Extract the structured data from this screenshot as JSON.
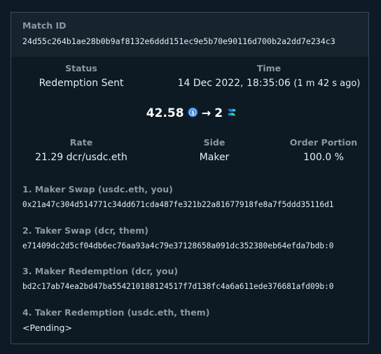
{
  "match": {
    "id_label": "Match ID",
    "id_value": "24d55c264b1ae28b0b9af8132e6ddd151ec9e5b70e90116d700b2a2dd7e234c3"
  },
  "status": {
    "label": "Status",
    "value": "Redemption Sent"
  },
  "time": {
    "label": "Time",
    "value": "14 Dec 2022, 18:35:06",
    "ago": "(1 m 42 s ago)"
  },
  "trade": {
    "from_amount": "42.58",
    "arrow": "→",
    "to_amount": "2",
    "from_icon": "usdc-icon",
    "to_icon": "dcr-icon",
    "from_color": "#2775ca",
    "to_color": "#2ed8a3"
  },
  "rate": {
    "label": "Rate",
    "value": "21.29 dcr/usdc.eth"
  },
  "side": {
    "label": "Side",
    "value": "Maker"
  },
  "portion": {
    "label": "Order Portion",
    "value": "100.0 %"
  },
  "swaps": [
    {
      "label": "1. Maker Swap (usdc.eth, you)",
      "value": "0x21a47c304d514771c34dd671cda487fe321b22a81677918fe8a7f5ddd35116d1"
    },
    {
      "label": "2. Taker Swap (dcr, them)",
      "value": "e71409dc2d5cf04db6ec76aa93a4c79e37128658a091dc352380eb64efda7bdb:0"
    },
    {
      "label": "3. Maker Redemption (dcr, you)",
      "value": "bd2c17ab74ea2bd47ba554210188124517f7d138fc4a6a611ede376681afd09b:0"
    },
    {
      "label": "4. Taker Redemption (usdc.eth, them)",
      "value": "<Pending>"
    }
  ]
}
